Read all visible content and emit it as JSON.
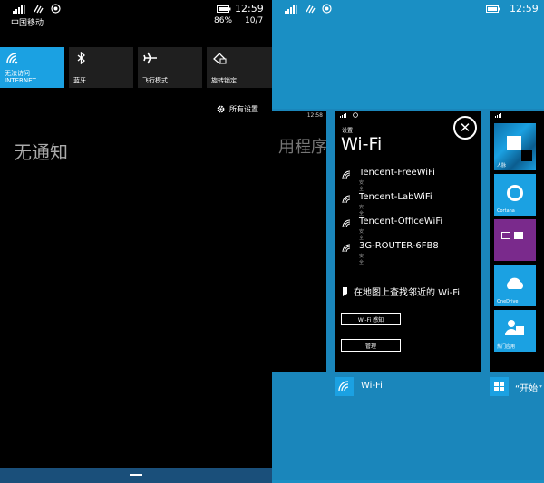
{
  "left_screen": {
    "status": {
      "time": "12:59",
      "carrier": "中国移动",
      "battery_pct": "86%",
      "date": "10/7"
    },
    "quick_actions": [
      {
        "label_line1": "无法访问",
        "label_line2": "INTERNET",
        "icon": "wifi-icon",
        "active": true
      },
      {
        "label_line1": "蓝牙",
        "label_line2": "",
        "icon": "bluetooth-icon",
        "active": false
      },
      {
        "label_line1": "飞行模式",
        "label_line2": "",
        "icon": "airplane-icon",
        "active": false
      },
      {
        "label_line1": "旋转锁定",
        "label_line2": "",
        "icon": "rotation-lock-icon",
        "active": false
      }
    ],
    "all_settings_label": "所有设置",
    "no_notifications_label": "无通知"
  },
  "right_screen": {
    "status": {
      "time": "12:59"
    },
    "left_card": {
      "time": "12:58",
      "partial_title": "用程序"
    },
    "wifi_card": {
      "caption": "设置",
      "title": "Wi-Fi",
      "networks": [
        {
          "name": "Tencent-FreeWiFi",
          "status": "安全"
        },
        {
          "name": "Tencent-LabWiFi",
          "status": "安全"
        },
        {
          "name": "Tencent-OfficeWiFi",
          "status": "安全"
        },
        {
          "name": "3G-ROUTER-6FB8",
          "status": "安全"
        }
      ],
      "map_label": "在地图上查找邻近的 Wi-Fi",
      "sense_button": "Wi-Fi 感知",
      "manage_button": "管理"
    },
    "start_card": {
      "tiles": [
        {
          "label": "人脉",
          "color": "#1ba1e2"
        },
        {
          "label": "Cortana",
          "color": "#1ba1e2"
        },
        {
          "label": "",
          "color": "#7a2a8c"
        },
        {
          "label": "OneDrive",
          "color": "#1ba1e2"
        },
        {
          "label": "热门应用",
          "color": "#1ba1e2"
        }
      ]
    },
    "app_labels": {
      "wifi": "Wi-Fi",
      "start": "“开始”"
    }
  },
  "colors": {
    "accent": "#1ba1e2",
    "switcher_bg": "#1a8fc4",
    "tile_bg": "#1f1f1f"
  }
}
